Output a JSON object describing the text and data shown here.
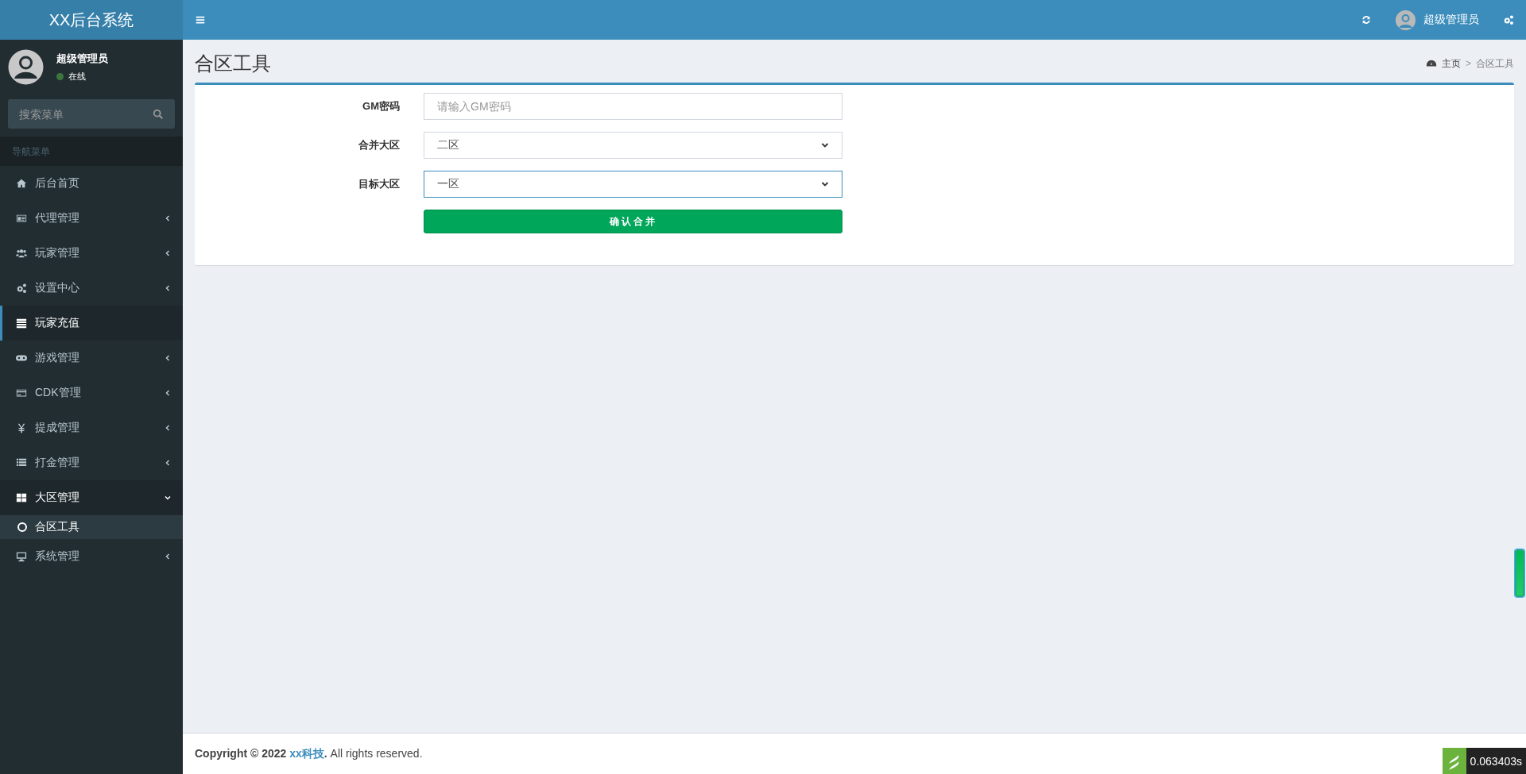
{
  "header": {
    "logo": "XX后台系统",
    "user_name": "超级管理员"
  },
  "sidebar": {
    "user": {
      "name": "超级管理员",
      "status": "在线"
    },
    "search": {
      "placeholder": "搜索菜单"
    },
    "nav_header": "导航菜单",
    "items": [
      {
        "label": "后台首页",
        "kind": "link",
        "selected": false
      },
      {
        "label": "代理管理",
        "kind": "tree",
        "selected": false,
        "expanded": false
      },
      {
        "label": "玩家管理",
        "kind": "tree",
        "selected": false,
        "expanded": false
      },
      {
        "label": "设置中心",
        "kind": "tree",
        "selected": false,
        "expanded": false
      },
      {
        "label": "玩家充值",
        "kind": "link",
        "selected": true
      },
      {
        "label": "游戏管理",
        "kind": "tree",
        "selected": false,
        "expanded": false
      },
      {
        "label": "CDK管理",
        "kind": "tree",
        "selected": false,
        "expanded": false
      },
      {
        "label": "提成管理",
        "kind": "tree",
        "selected": false,
        "expanded": false
      },
      {
        "label": "打金管理",
        "kind": "tree",
        "selected": false,
        "expanded": false
      },
      {
        "label": "大区管理",
        "kind": "tree",
        "selected": false,
        "expanded": true,
        "children": [
          {
            "label": "合区工具",
            "selected": true
          }
        ]
      },
      {
        "label": "系统管理",
        "kind": "tree",
        "selected": false,
        "expanded": false
      }
    ]
  },
  "content": {
    "title": "合区工具",
    "breadcrumb": [
      "主页",
      "合区工具"
    ],
    "breadcrumb_separator": ">",
    "form": {
      "fields": [
        {
          "label": "GM密码",
          "kind": "input",
          "placeholder": "请输入GM密码",
          "focused": false
        },
        {
          "label": "合并大区",
          "kind": "select",
          "value": "二区",
          "focused": false
        },
        {
          "label": "目标大区",
          "kind": "select",
          "value": "一区",
          "focused": true
        }
      ],
      "submit": "确认合并"
    }
  },
  "footer": {
    "prefix": "Copyright © 2022",
    "link": "xx科技",
    "suffix": "**.** All rights reserved."
  },
  "trace": {
    "time": "0.063403s"
  }
}
